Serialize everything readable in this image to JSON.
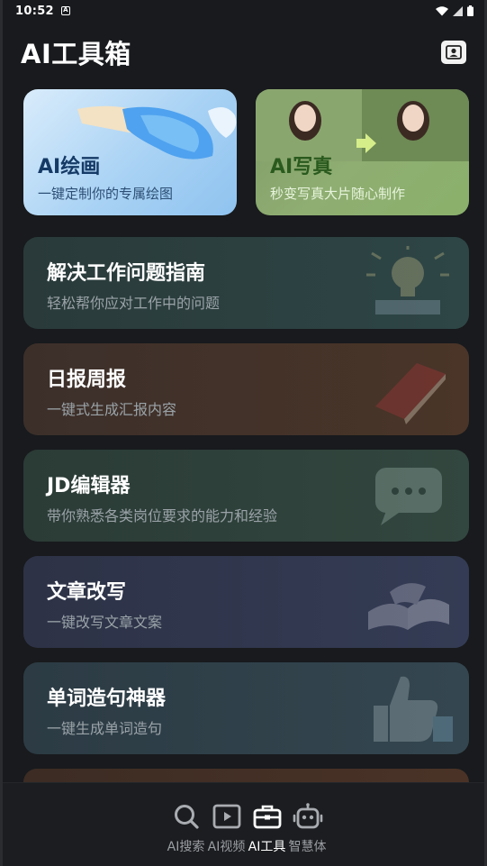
{
  "status_bar": {
    "time": "10:52",
    "notification_glyph": "A",
    "icons": [
      "wifi-icon",
      "signal-icon",
      "battery-icon"
    ]
  },
  "header": {
    "title": "AI工具箱",
    "profile_icon": "profile-card-icon"
  },
  "features": [
    {
      "title": "AI绘画",
      "subtitle": "一键定制你的专属绘图"
    },
    {
      "title": "AI写真",
      "subtitle": "秒变写真大片随心制作"
    }
  ],
  "tools": [
    {
      "title": "解决工作问题指南",
      "subtitle": "轻松帮你应对工作中的问题",
      "icon": "lightbulb-icon"
    },
    {
      "title": "日报周报",
      "subtitle": "一键式生成汇报内容",
      "icon": "notebook-icon"
    },
    {
      "title": "JD编辑器",
      "subtitle": "带你熟悉各类岗位要求的能力和经验",
      "icon": "chat-bubble-icon"
    },
    {
      "title": "文章改写",
      "subtitle": "一键改写文章文案",
      "icon": "open-book-icon"
    },
    {
      "title": "单词造句神器",
      "subtitle": "一键生成单词造句",
      "icon": "thumbs-up-icon"
    }
  ],
  "bottom_nav": {
    "items": [
      {
        "label": "AI搜索",
        "icon": "search-icon"
      },
      {
        "label": "AI视频",
        "icon": "video-play-icon"
      },
      {
        "label": "AI工具",
        "icon": "toolbox-icon",
        "active": true
      },
      {
        "label": "智慧体",
        "icon": "robot-icon"
      }
    ]
  },
  "colors": {
    "background": "#181a1d",
    "active_nav": "#ffffff",
    "inactive_nav": "#9a9da2"
  }
}
